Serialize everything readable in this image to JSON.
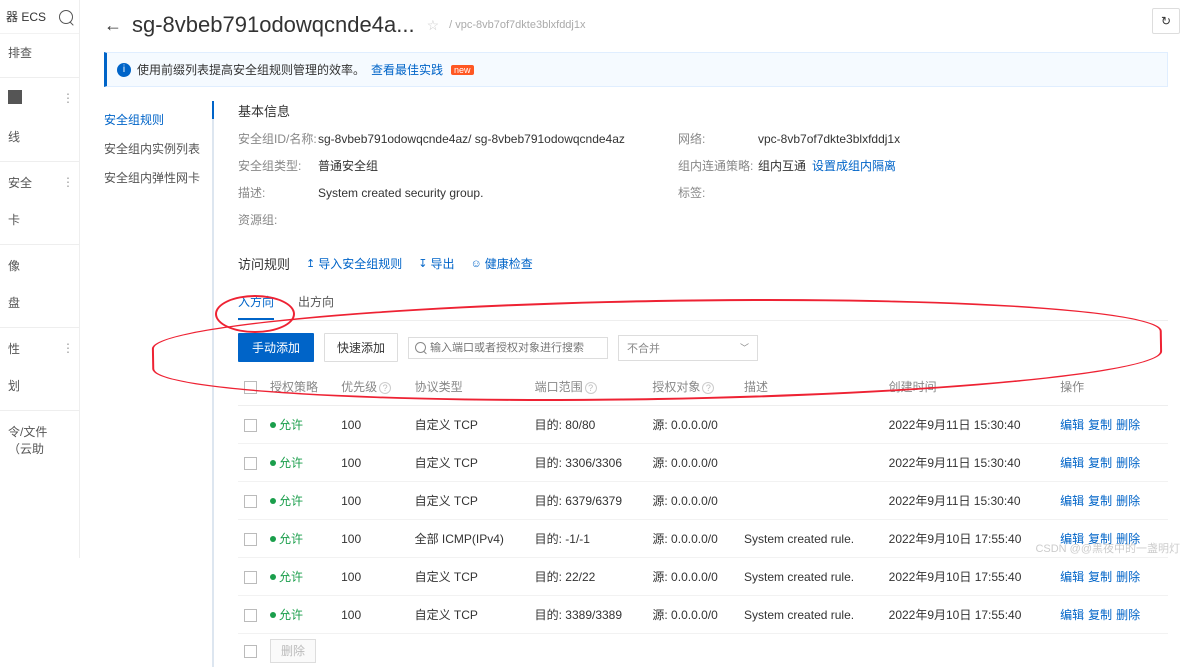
{
  "leftPanel": {
    "product": "器 ECS",
    "items": [
      "排查",
      "线",
      "安全",
      "卡",
      "像",
      "盘",
      "性",
      "划",
      "令/文件（云助"
    ]
  },
  "header": {
    "title": "sg-8vbeb791odowqcnde4a...",
    "breadcrumb": "/ vpc-8vb7of7dkte3blxfddj1x"
  },
  "alert": {
    "text": "使用前缀列表提高安全组规则管理的效率。",
    "link": "查看最佳实践",
    "badge": "new"
  },
  "leftNav": [
    "安全组规则",
    "安全组内实例列表",
    "安全组内弹性网卡"
  ],
  "basicInfo": {
    "title": "基本信息",
    "rows": [
      {
        "l1": "安全组ID/名称:",
        "v1": "sg-8vbeb791odowqcnde4az/ sg-8vbeb791odowqcnde4az",
        "l2": "网络:",
        "v2": "vpc-8vb7of7dkte3blxfddj1x"
      },
      {
        "l1": "安全组类型:",
        "v1": "普通安全组",
        "l2": "组内连通策略:",
        "v2": "组内互通",
        "link2": "设置成组内隔离"
      },
      {
        "l1": "描述:",
        "v1": "System created security group.",
        "l2": "标签:",
        "v2": ""
      },
      {
        "l1": "资源组:",
        "v1": "",
        "l2": "",
        "v2": ""
      }
    ]
  },
  "rulesHeader": {
    "title": "访问规则",
    "import": "导入安全组规则",
    "export": "导出",
    "health": "健康检查"
  },
  "tabs": {
    "in": "入方向",
    "out": "出方向"
  },
  "toolbar": {
    "manual": "手动添加",
    "quick": "快速添加",
    "searchPlaceholder": "输入端口或者授权对象进行搜索",
    "merge": "不合并"
  },
  "columns": {
    "policy": "授权策略",
    "priority": "优先级",
    "protocol": "协议类型",
    "port": "端口范围",
    "target": "授权对象",
    "desc": "描述",
    "time": "创建时间",
    "op": "操作"
  },
  "allow": "允许",
  "actions": {
    "edit": "编辑",
    "copy": "复制",
    "del": "删除"
  },
  "rows": [
    {
      "priority": "100",
      "protocol": "自定义 TCP",
      "port": "目的: 80/80",
      "target": "源: 0.0.0.0/0",
      "desc": "",
      "time": "2022年9月11日 15:30:40"
    },
    {
      "priority": "100",
      "protocol": "自定义 TCP",
      "port": "目的: 3306/3306",
      "target": "源: 0.0.0.0/0",
      "desc": "",
      "time": "2022年9月11日 15:30:40"
    },
    {
      "priority": "100",
      "protocol": "自定义 TCP",
      "port": "目的: 6379/6379",
      "target": "源: 0.0.0.0/0",
      "desc": "",
      "time": "2022年9月11日 15:30:40"
    },
    {
      "priority": "100",
      "protocol": "全部 ICMP(IPv4)",
      "port": "目的: -1/-1",
      "target": "源: 0.0.0.0/0",
      "desc": "System created rule.",
      "time": "2022年9月10日 17:55:40"
    },
    {
      "priority": "100",
      "protocol": "自定义 TCP",
      "port": "目的: 22/22",
      "target": "源: 0.0.0.0/0",
      "desc": "System created rule.",
      "time": "2022年9月10日 17:55:40"
    },
    {
      "priority": "100",
      "protocol": "自定义 TCP",
      "port": "目的: 3389/3389",
      "target": "源: 0.0.0.0/0",
      "desc": "System created rule.",
      "time": "2022年9月10日 17:55:40"
    }
  ],
  "footer": {
    "delete": "删除"
  },
  "watermark": "CSDN @@黑夜中的一盏明灯"
}
